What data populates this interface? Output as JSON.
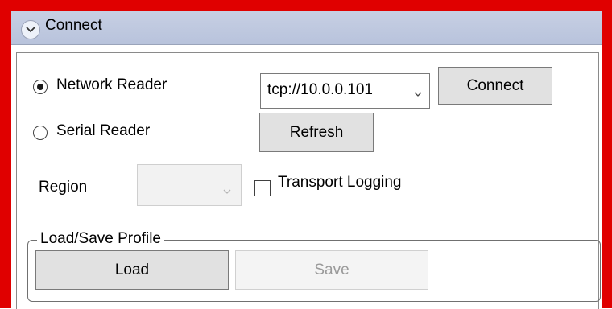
{
  "header": {
    "title": "Connect",
    "expander_icon": "chevron-down-icon"
  },
  "reader_type": {
    "network_label": "Network Reader",
    "serial_label": "Serial Reader",
    "selected": "network"
  },
  "address": {
    "value": "tcp://10.0.0.101"
  },
  "buttons": {
    "connect": "Connect",
    "refresh": "Refresh"
  },
  "region": {
    "label": "Region",
    "value": ""
  },
  "transport_logging": {
    "label": "Transport Logging",
    "checked": false
  },
  "profile": {
    "legend": "Load/Save Profile",
    "load": "Load",
    "save": "Save"
  },
  "colors": {
    "frame": "#e00000",
    "header": "#bcc6de"
  }
}
